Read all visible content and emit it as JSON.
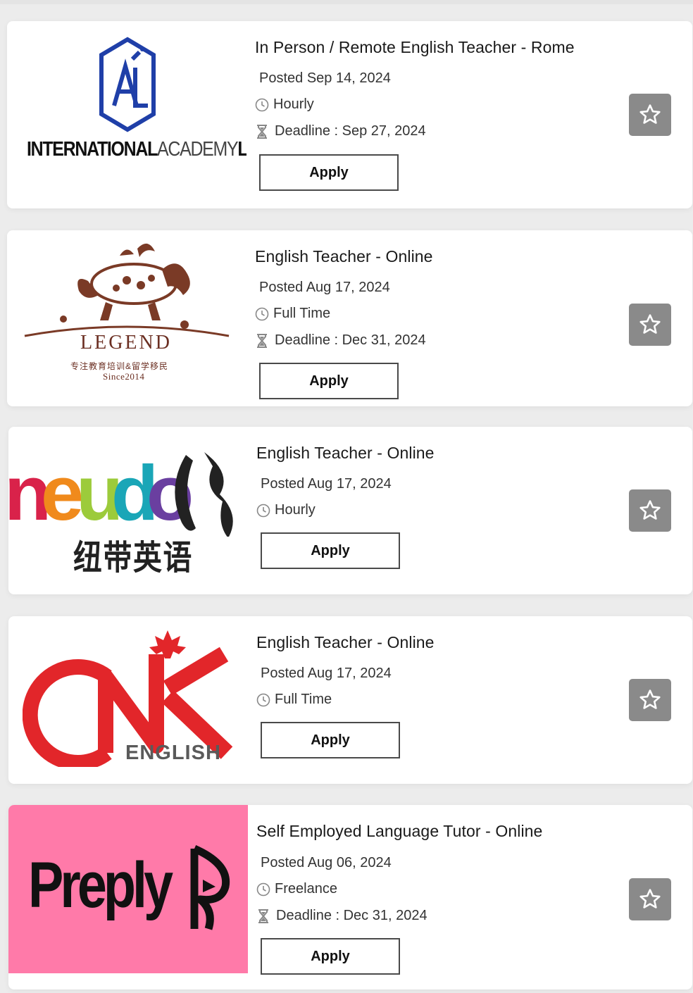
{
  "jobs": [
    {
      "company_logo": "International Academy Lab",
      "logo_text_bold_1": "INTERNATIONAL",
      "logo_text_thin": "ACADEMY",
      "logo_text_bold_2": "LAB",
      "title": "In Person / Remote English Teacher - Rome",
      "posted": "Posted Sep 14, 2024",
      "type": "Hourly",
      "deadline": "Deadline : Sep 27, 2024",
      "apply_label": "Apply"
    },
    {
      "company_logo": "Legend",
      "logo_word": "LEGEND",
      "logo_cn": "专注教育培训&留学移民",
      "logo_since": "Since2014",
      "title": "English Teacher - Online",
      "posted": "Posted Aug 17, 2024",
      "type": "Full Time",
      "deadline": "Deadline : Dec 31, 2024",
      "apply_label": "Apply"
    },
    {
      "company_logo": "neudoc 纽带英语",
      "logo_word": "neudoc",
      "logo_cn": "纽带英语",
      "title": "English Teacher - Online",
      "posted": "Posted Aug 17, 2024",
      "type": "Hourly",
      "apply_label": "Apply"
    },
    {
      "company_logo": "CNK English",
      "logo_word": "CNK",
      "logo_sub": "ENGLISH",
      "title": "English Teacher - Online",
      "posted": "Posted Aug 17, 2024",
      "type": "Full Time",
      "apply_label": "Apply"
    },
    {
      "company_logo": "Preply",
      "logo_word": "Preply",
      "title": "Self Employed Language Tutor - Online",
      "posted": "Posted Aug 06, 2024",
      "type": "Freelance",
      "deadline": "Deadline : Dec 31, 2024",
      "apply_label": "Apply"
    }
  ],
  "icons": {
    "clock": "clock-icon",
    "hourglass": "hourglass-icon",
    "star": "star-outline-icon"
  },
  "colors": {
    "star_button": "#8a8a8a",
    "preply_pink": "#ff7aa9",
    "legend_brown": "#6b2f22",
    "cnk_red": "#e2262a",
    "ial_blue": "#1f3fa8"
  }
}
